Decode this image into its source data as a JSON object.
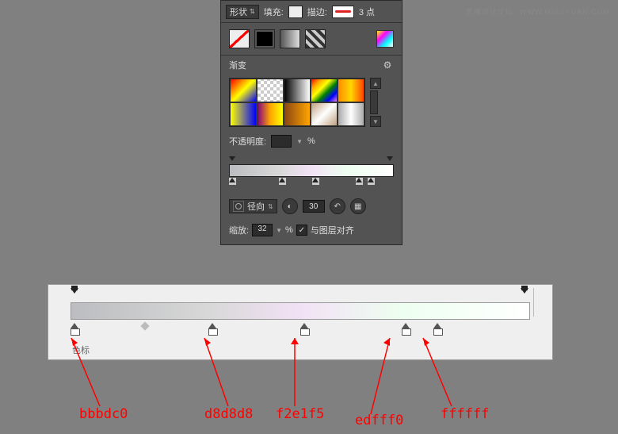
{
  "watermark": {
    "text": "思缘设计论坛",
    "url": "WWW.MISSYUAN.COM"
  },
  "titlebar": {
    "shape_label": "形状",
    "fill_label": "填充:",
    "stroke_label": "描边:",
    "stroke_size": "3 点"
  },
  "section": {
    "gradient_title": "渐变",
    "opacity_label": "不透明度:",
    "percent": "%",
    "type_label": "径向",
    "angle": "30",
    "scale_label": "缩放:",
    "scale_value": "32",
    "align_label": "与图层对齐"
  },
  "bottom": {
    "footer_label": "色标"
  },
  "colors": {
    "c1": "bbbdc0",
    "c2": "d8d8d8",
    "c3": "f2e1f5",
    "c4": "edfff0",
    "c5": "ffffff"
  }
}
